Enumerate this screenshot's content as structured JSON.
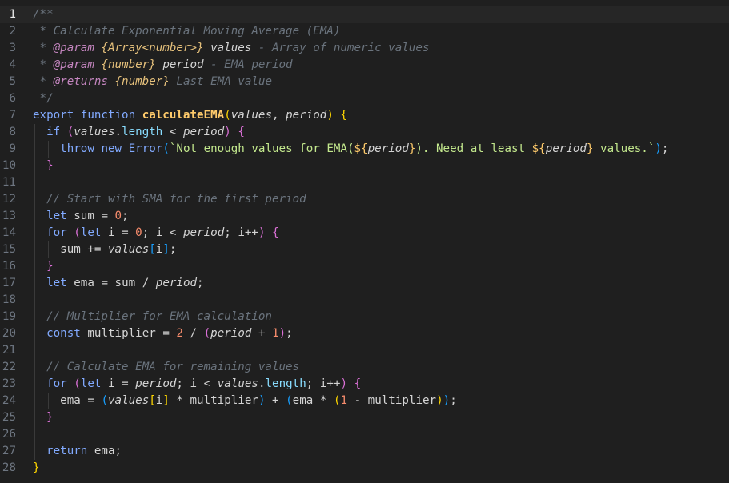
{
  "editor": {
    "active_line": 1,
    "line_numbers": [
      "1",
      "2",
      "3",
      "4",
      "5",
      "6",
      "7",
      "8",
      "9",
      "10",
      "11",
      "12",
      "13",
      "14",
      "15",
      "16",
      "17",
      "18",
      "19",
      "20",
      "21",
      "22",
      "23",
      "24",
      "25",
      "26",
      "27",
      "28"
    ],
    "lines": [
      "/**",
      " * Calculate Exponential Moving Average (EMA)",
      " * @param {Array<number>} values - Array of numeric values",
      " * @param {number} period - EMA period",
      " * @returns {number} Last EMA value",
      " */",
      "export function calculateEMA(values, period) {",
      "  if (values.length < period) {",
      "    throw new Error(`Not enough values for EMA(${period}). Need at least ${period} values.`);",
      "  }",
      "",
      "  // Start with SMA for the first period",
      "  let sum = 0;",
      "  for (let i = 0; i < period; i++) {",
      "    sum += values[i];",
      "  }",
      "  let ema = sum / period;",
      "",
      "  // Multiplier for EMA calculation",
      "  const multiplier = 2 / (period + 1);",
      "",
      "  // Calculate EMA for remaining values",
      "  for (let i = period; i < values.length; i++) {",
      "    ema = (values[i] * multiplier) + (ema * (1 - multiplier));",
      "  }",
      "",
      "  return ema;",
      "}"
    ]
  },
  "colors": {
    "background": "#1f1f1f",
    "active_line": "#262626",
    "keyword": "#82aaff",
    "function_name": "#ffcb6b",
    "number": "#f78c6c",
    "comment": "#6a737d"
  }
}
